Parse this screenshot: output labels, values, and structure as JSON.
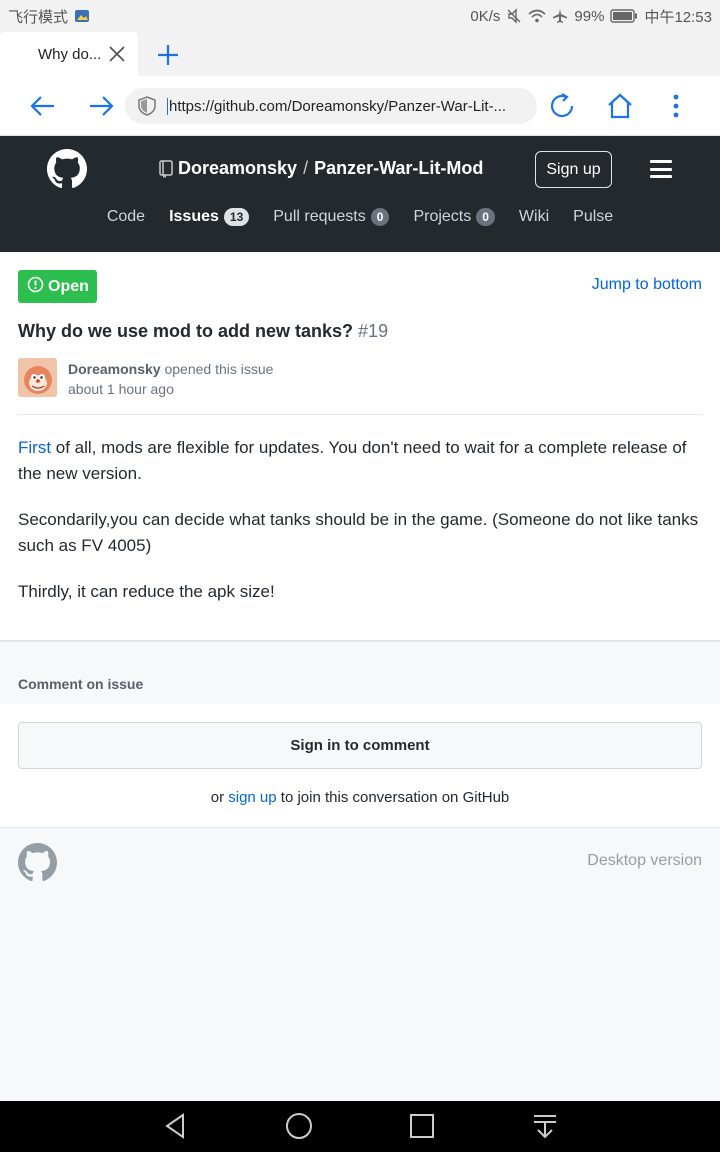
{
  "status_bar": {
    "left_text": "飞行模式",
    "speed": "0K/s",
    "battery": "99%",
    "time": "中午12:53"
  },
  "browser": {
    "tab_title": "Why do...",
    "url": "https://github.com/Doreamonsky/Panzer-War-Lit-..."
  },
  "github": {
    "owner": "Doreamonsky",
    "separator": "/",
    "repo": "Panzer-War-Lit-Mod",
    "signup_label": "Sign up",
    "nav": {
      "code": "Code",
      "issues": "Issues",
      "issues_count": "13",
      "pulls": "Pull requests",
      "pulls_count": "0",
      "projects": "Projects",
      "projects_count": "0",
      "wiki": "Wiki",
      "pulse": "Pulse"
    }
  },
  "issue": {
    "state": "Open",
    "jump_label": "Jump to bottom",
    "title": "Why do we use mod to add new tanks?",
    "number": "#19",
    "author": "Doreamonsky",
    "opened_text": "opened this issue",
    "time_ago": "about 1 hour ago",
    "body": {
      "p1_link": "First",
      "p1_rest": " of all, mods are flexible for updates. You don't need to wait for a complete release of the new version.",
      "p2": "Secondarily,you can decide what tanks should be in the game. (Someone do not like tanks such as FV 4005)",
      "p3": "Thirdly, it can reduce the apk size!"
    }
  },
  "comment": {
    "heading": "Comment on issue",
    "signin_label": "Sign in to comment",
    "or_text": "or",
    "signup_link": "sign up",
    "join_text": "to join this conversation on GitHub"
  },
  "footer": {
    "desktop_label": "Desktop version"
  },
  "colors": {
    "header_bg": "#24292e",
    "open_green": "#2cbe4e",
    "link_blue": "#0366d6",
    "browser_accent": "#1a73e8"
  }
}
